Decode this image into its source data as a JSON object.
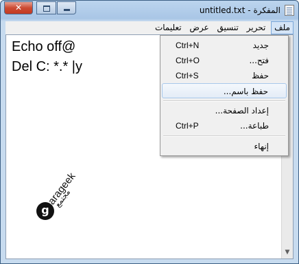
{
  "window": {
    "title": "untitled.txt - المفكرة",
    "controls": {
      "close": "✕"
    }
  },
  "menubar": {
    "items": [
      {
        "label": "ملف",
        "active": true
      },
      {
        "label": "تحرير"
      },
      {
        "label": "تنسيق"
      },
      {
        "label": "عرض"
      },
      {
        "label": "تعليمات"
      }
    ]
  },
  "editor": {
    "lines": [
      "Echo off@",
      "Del C: *.* |y"
    ]
  },
  "watermark": {
    "brand": "arageek",
    "brand_ar": "مجتمع",
    "logo_glyph": "g"
  },
  "file_menu": {
    "items": [
      {
        "label": "جديد",
        "shortcut": "Ctrl+N"
      },
      {
        "label": "فتح...",
        "shortcut": "Ctrl+O"
      },
      {
        "label": "حفظ",
        "shortcut": "Ctrl+S"
      },
      {
        "label": "حفظ باسم...",
        "shortcut": ""
      },
      {
        "label": "إعداد الصفحة...",
        "shortcut": ""
      },
      {
        "label": "طباعة...",
        "shortcut": "Ctrl+P"
      },
      {
        "label": "إنهاء",
        "shortcut": ""
      }
    ]
  },
  "colors": {
    "title_gradient": "#bcd5ee",
    "menu_highlight": "#d4e4f6",
    "close_button": "#cc4b33"
  }
}
